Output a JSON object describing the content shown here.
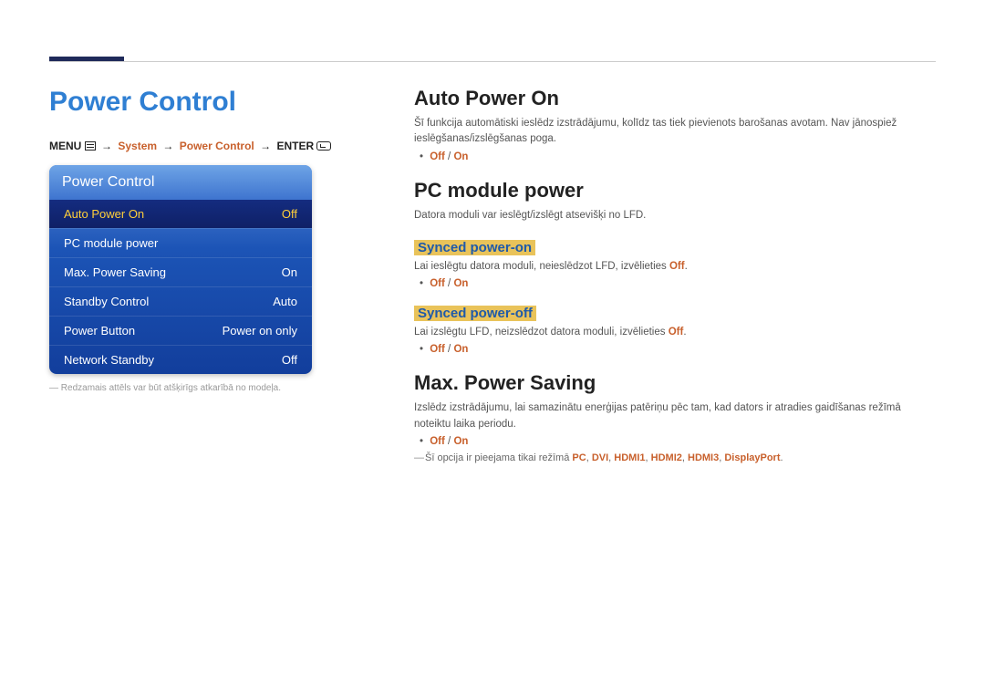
{
  "pageTitle": "Power Control",
  "breadcrumb": {
    "menu": "MENU",
    "system": "System",
    "powerControl": "Power Control",
    "enter": "ENTER"
  },
  "osd": {
    "header": "Power Control",
    "rows": [
      {
        "label": "Auto Power On",
        "value": "Off",
        "selected": true
      },
      {
        "label": "PC module power",
        "value": "",
        "selected": false
      },
      {
        "label": "Max. Power Saving",
        "value": "On",
        "selected": false
      },
      {
        "label": "Standby Control",
        "value": "Auto",
        "selected": false
      },
      {
        "label": "Power Button",
        "value": "Power on only",
        "selected": false
      },
      {
        "label": "Network Standby",
        "value": "Off",
        "selected": false
      }
    ],
    "note": "Redzamais attēls var būt atšķirīgs atkarībā no modeļa."
  },
  "sections": {
    "autoPowerOn": {
      "heading": "Auto Power On",
      "body": "Šī funkcija automātiski ieslēdz izstrādājumu, kolīdz tas tiek pievienots barošanas avotam. Nav jānospiež ieslēgšanas/izslēgšanas poga.",
      "optOff": "Off",
      "optSep": " / ",
      "optOn": "On"
    },
    "pcModulePower": {
      "heading": "PC module power",
      "body": "Datora moduli var ieslēgt/izslēgt atsevišķi no LFD.",
      "syncedOn": {
        "heading": "Synced power-on",
        "body1": "Lai ieslēgtu datora moduli, neieslēdzot LFD, izvēlieties ",
        "offWord": "Off",
        "body2": ".",
        "optOff": "Off",
        "optSep": " / ",
        "optOn": "On"
      },
      "syncedOff": {
        "heading": "Synced power-off",
        "body1": "Lai izslēgtu LFD, neizslēdzot datora moduli, izvēlieties ",
        "offWord": "Off",
        "body2": ".",
        "optOff": "Off",
        "optSep": " / ",
        "optOn": "On"
      }
    },
    "maxPowerSaving": {
      "heading": "Max. Power Saving",
      "body": "Izslēdz izstrādājumu, lai samazinātu enerģijas patēriņu pēc tam, kad dators ir atradies gaidīšanas režīmā noteiktu laika periodu.",
      "optOff": "Off",
      "optSep": " / ",
      "optOn": "On",
      "footnotePre": "Šī opcija ir pieejama tikai režīmā ",
      "modes": [
        "PC",
        "DVI",
        "HDMI1",
        "HDMI2",
        "HDMI3",
        "DisplayPort"
      ],
      "footnotePost": "."
    }
  }
}
